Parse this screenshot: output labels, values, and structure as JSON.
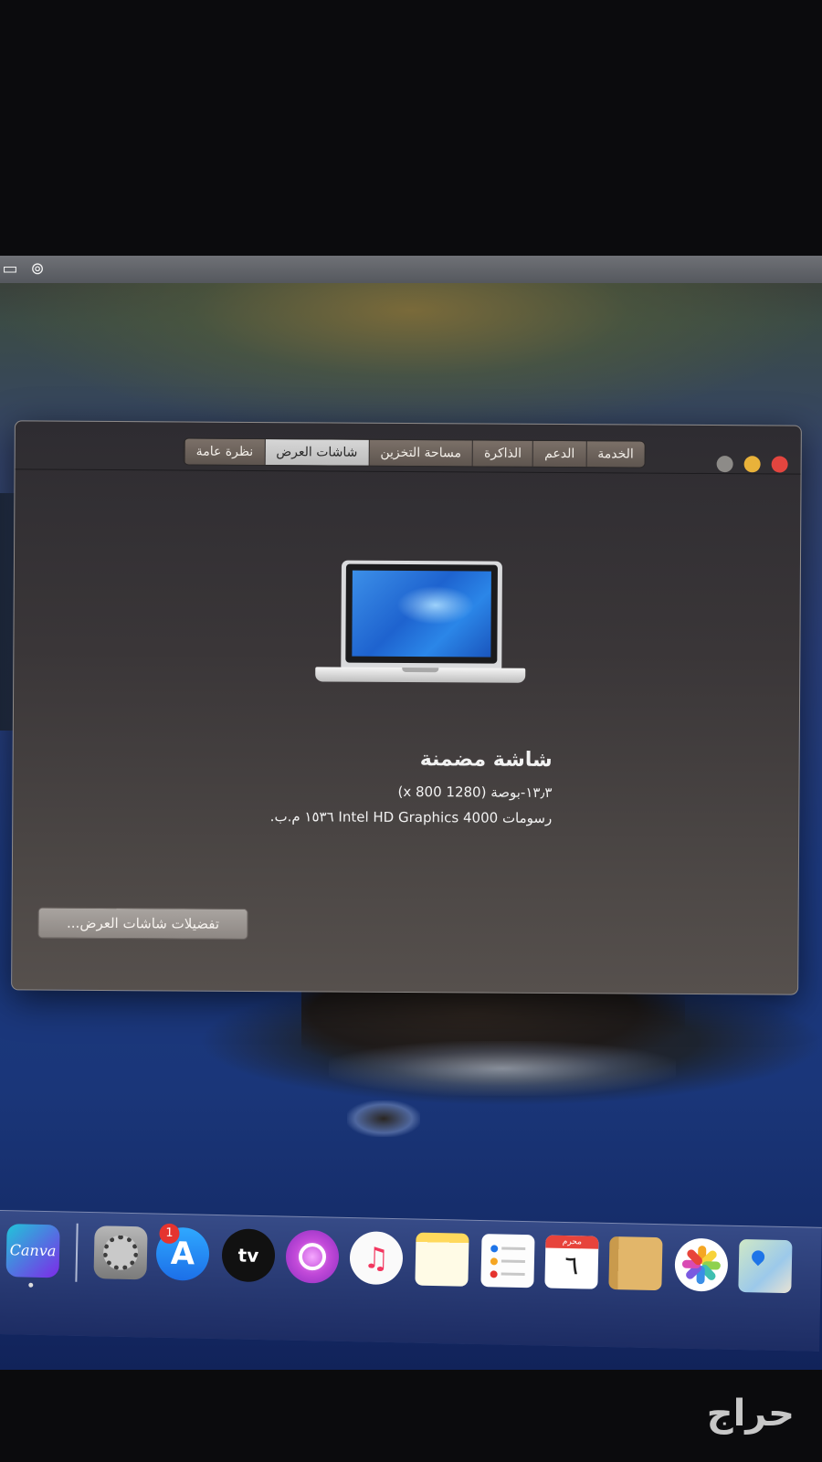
{
  "window": {
    "tabs": [
      {
        "label": "نظرة عامة",
        "selected": false
      },
      {
        "label": "شاشات العرض",
        "selected": true
      },
      {
        "label": "مساحة التخزين",
        "selected": false
      },
      {
        "label": "الذاكرة",
        "selected": false
      },
      {
        "label": "الدعم",
        "selected": false
      },
      {
        "label": "الخدمة",
        "selected": false
      }
    ],
    "display": {
      "title": "شاشة مضمنة",
      "size_line": "١٣٫٣-بوصة (1280 x 800)",
      "graphics_line": "رسومات Intel HD Graphics 4000 ١٥٣٦ م.ب."
    },
    "prefs_button_label": "تفضيلات شاشات العرض..."
  },
  "dock": {
    "canva_label": "Canva",
    "appstore_badge": "1",
    "tv_label": "tv",
    "calendar_month": "محرم",
    "calendar_day": "٦",
    "icons": [
      "canva-icon",
      "system-preferences-icon",
      "app-store-icon",
      "apple-tv-icon",
      "podcasts-icon",
      "music-icon",
      "notes-icon",
      "reminders-icon",
      "calendar-icon",
      "contacts-icon",
      "photos-icon",
      "maps-icon"
    ]
  },
  "watermark": "حراج",
  "colors": {
    "close": "#e3453f",
    "minimize": "#e9b23a",
    "zoom": "#8d8b88",
    "selected_tab": "#cfcfcf"
  }
}
